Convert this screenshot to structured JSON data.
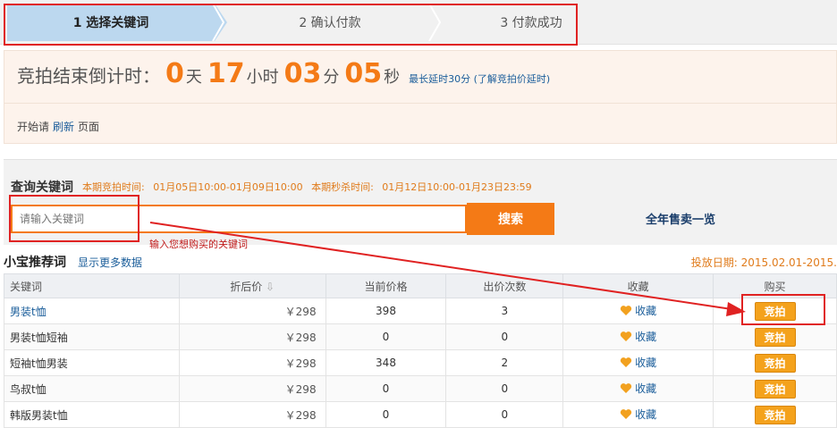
{
  "steps": [
    {
      "label": "1 选择关键词"
    },
    {
      "label": "2 确认付款"
    },
    {
      "label": "3 付款成功"
    }
  ],
  "countdown": {
    "label": "竞拍结束倒计时：",
    "days": "0",
    "days_unit": "天",
    "hours": "17",
    "hours_unit": "小时",
    "minutes": "03",
    "minutes_unit": "分",
    "seconds": "05",
    "seconds_unit": "秒",
    "note": "最长延时30分 (了解竞拍价延时)",
    "refresh_prefix": "开始请",
    "refresh_link": "刷新",
    "refresh_suffix": "页面"
  },
  "search": {
    "title": "查询关键词",
    "period_label": "本期竞拍时间:",
    "period_value": "01月05日10:00-01月09日10:00",
    "flash_label": "本期秒杀时间:",
    "flash_value": "01月12日10:00-01月23日23:59",
    "placeholder": "请输入关键词",
    "button": "搜索",
    "side_link": "全年售卖一览",
    "hint": "输入您想购买的关键词"
  },
  "recommend": {
    "title": "小宝推荐词",
    "more": "显示更多数据",
    "date": "投放日期: 2015.02.01-2015."
  },
  "table": {
    "headers": [
      "关键词",
      "折后价",
      "当前价格",
      "出价次数",
      "收藏",
      "购买"
    ],
    "rows": [
      {
        "keyword": "男装t恤",
        "discount": "￥298",
        "price": "398",
        "bids": "3",
        "fav": "收藏",
        "buy": "竞拍"
      },
      {
        "keyword": "男装t恤短袖",
        "discount": "￥298",
        "price": "0",
        "bids": "0",
        "fav": "收藏",
        "buy": "竞拍"
      },
      {
        "keyword": "短袖t恤男装",
        "discount": "￥298",
        "price": "348",
        "bids": "2",
        "fav": "收藏",
        "buy": "竞拍"
      },
      {
        "keyword": "鸟叔t恤",
        "discount": "￥298",
        "price": "0",
        "bids": "0",
        "fav": "收藏",
        "buy": "竞拍"
      },
      {
        "keyword": "韩版男装t恤",
        "discount": "￥298",
        "price": "0",
        "bids": "0",
        "fav": "收藏",
        "buy": "竞拍"
      }
    ]
  },
  "colors": {
    "accent": "#f47a16",
    "annotation": "#e02222",
    "link": "#1a5d9a"
  }
}
